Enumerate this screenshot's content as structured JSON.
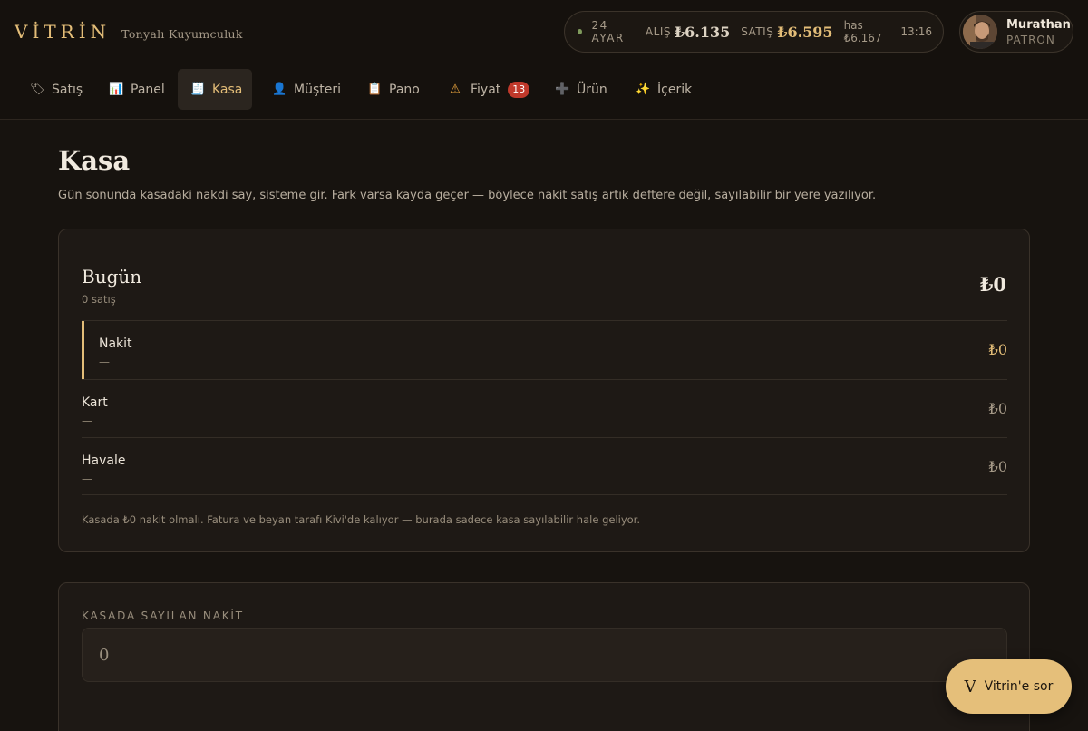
{
  "brand": {
    "name": "VİTRİN",
    "subtitle": "Tonyalı Kuyumculuk"
  },
  "ticker": {
    "status_color": "#7f9a5c",
    "karat": "24 AYAR",
    "buy_label": "ALIŞ",
    "buy_value": "₺6.135",
    "sell_label": "SATIŞ",
    "sell_value": "₺6.595",
    "has": "has ₺6.167",
    "time": "13:16"
  },
  "user": {
    "name": "Murathan",
    "role": "PATRON"
  },
  "nav": {
    "tabs": [
      {
        "icon": "tag-icon",
        "glyph": "🏷",
        "label": "Satış"
      },
      {
        "icon": "chart-icon",
        "glyph": "📊",
        "label": "Panel"
      },
      {
        "icon": "receipt-icon",
        "glyph": "🧾",
        "label": "Kasa"
      },
      {
        "icon": "person-icon",
        "glyph": "👤",
        "label": "Müşteri"
      },
      {
        "icon": "clipboard-icon",
        "glyph": "📋",
        "label": "Pano"
      },
      {
        "icon": "warning-icon",
        "glyph": "⚠",
        "label": "Fiyat",
        "badge": "13"
      },
      {
        "icon": "plus-icon",
        "glyph": "➕",
        "label": "Ürün"
      },
      {
        "icon": "sparkles-icon",
        "glyph": "✨",
        "label": "İçerik"
      }
    ],
    "active": "Kasa"
  },
  "page": {
    "title": "Kasa",
    "description": "Gün sonunda kasadaki nakdi say, sisteme gir. Fark varsa kayda geçer — böylece nakit satış artık deftere değil, sayılabilir bir yere yazılıyor."
  },
  "today": {
    "title": "Bugün",
    "subtitle": "0 satış",
    "total": "₺0",
    "rows": [
      {
        "name": "Nakit",
        "detail": "—",
        "amount": "₺0"
      },
      {
        "name": "Kart",
        "detail": "—",
        "amount": "₺0"
      },
      {
        "name": "Havale",
        "detail": "—",
        "amount": "₺0"
      }
    ],
    "note": "Kasada ₺0 nakit olmalı. Fatura ve beyan tarafı Kivi'de kalıyor — burada sadece kasa sayılabilir hale geliyor."
  },
  "count": {
    "label": "KASADA SAYILAN NAKİT",
    "placeholder": "0"
  },
  "assistant": {
    "label": "Vitrin'e sor",
    "initial": "V"
  },
  "colors": {
    "accent": "#e3bd78",
    "background": "#17130f",
    "badge": "#c0392b"
  }
}
